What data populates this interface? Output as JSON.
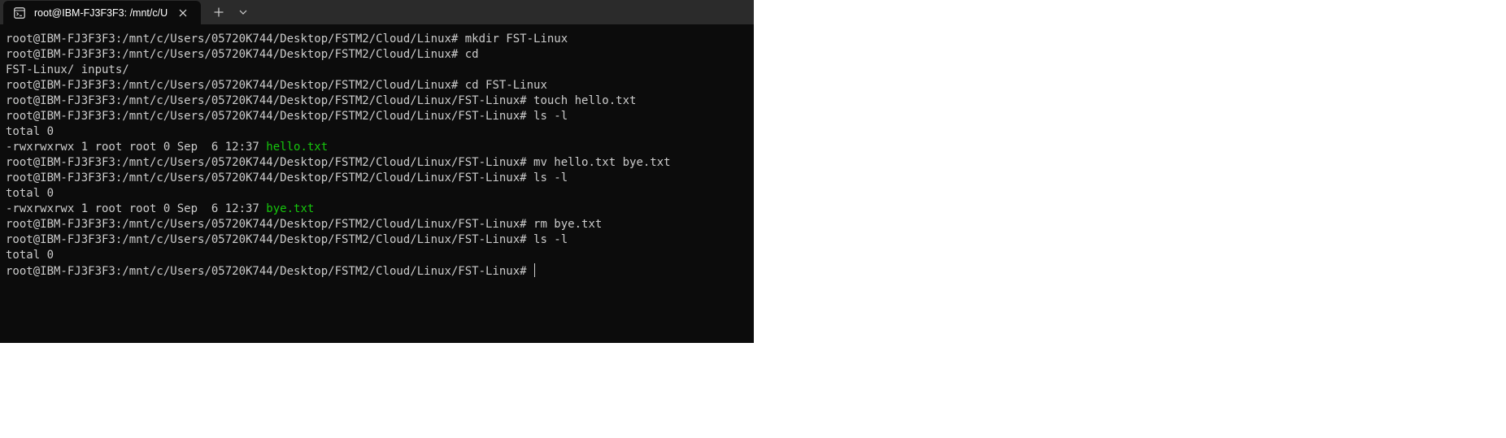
{
  "tab": {
    "title": "root@IBM-FJ3F3F3: /mnt/c/U",
    "icon": "terminal-icon"
  },
  "colors": {
    "window_bg": "#0c0c0c",
    "tabbar_bg": "#2b2b2b",
    "text": "#cccccc",
    "highlight": "#16c60c"
  },
  "terminal": {
    "lines": [
      {
        "text": "root@IBM-FJ3F3F3:/mnt/c/Users/05720K744/Desktop/FSTM2/Cloud/Linux# mkdir FST-Linux"
      },
      {
        "text": "root@IBM-FJ3F3F3:/mnt/c/Users/05720K744/Desktop/FSTM2/Cloud/Linux# cd"
      },
      {
        "text": "FST-Linux/ inputs/"
      },
      {
        "text": "root@IBM-FJ3F3F3:/mnt/c/Users/05720K744/Desktop/FSTM2/Cloud/Linux# cd FST-Linux"
      },
      {
        "text": "root@IBM-FJ3F3F3:/mnt/c/Users/05720K744/Desktop/FSTM2/Cloud/Linux/FST-Linux# touch hello.txt"
      },
      {
        "text": "root@IBM-FJ3F3F3:/mnt/c/Users/05720K744/Desktop/FSTM2/Cloud/Linux/FST-Linux# ls -l"
      },
      {
        "text": "total 0"
      },
      {
        "text": "-rwxrwxrwx 1 root root 0 Sep  6 12:37 ",
        "highlight": "hello.txt"
      },
      {
        "text": "root@IBM-FJ3F3F3:/mnt/c/Users/05720K744/Desktop/FSTM2/Cloud/Linux/FST-Linux# mv hello.txt bye.txt"
      },
      {
        "text": "root@IBM-FJ3F3F3:/mnt/c/Users/05720K744/Desktop/FSTM2/Cloud/Linux/FST-Linux# ls -l"
      },
      {
        "text": "total 0"
      },
      {
        "text": "-rwxrwxrwx 1 root root 0 Sep  6 12:37 ",
        "highlight": "bye.txt"
      },
      {
        "text": "root@IBM-FJ3F3F3:/mnt/c/Users/05720K744/Desktop/FSTM2/Cloud/Linux/FST-Linux# rm bye.txt"
      },
      {
        "text": "root@IBM-FJ3F3F3:/mnt/c/Users/05720K744/Desktop/FSTM2/Cloud/Linux/FST-Linux# ls -l"
      },
      {
        "text": "total 0"
      },
      {
        "text": "root@IBM-FJ3F3F3:/mnt/c/Users/05720K744/Desktop/FSTM2/Cloud/Linux/FST-Linux# ",
        "cursor": true
      }
    ]
  }
}
